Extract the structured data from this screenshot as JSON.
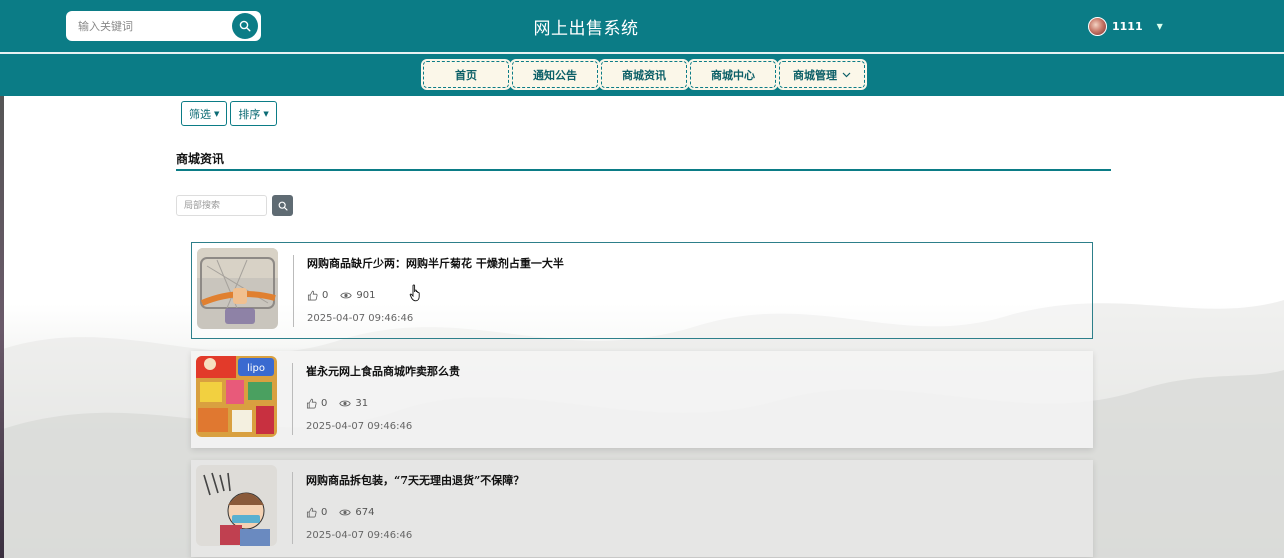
{
  "header": {
    "search_placeholder": "输入关键词",
    "site_title": "网上出售系统",
    "user_name": "1111",
    "accent_color": "#0b7c86"
  },
  "nav": {
    "items": [
      {
        "label": "首页"
      },
      {
        "label": "通知公告"
      },
      {
        "label": "商城资讯",
        "active": true
      },
      {
        "label": "商城中心"
      },
      {
        "label": "商城管理"
      }
    ]
  },
  "filters": {
    "filter_label": "筛选",
    "sort_label": "排序"
  },
  "section": {
    "title": "商城资讯",
    "local_search_placeholder": "局部搜索"
  },
  "articles": [
    {
      "title": "网购商品缺斤少两：网购半斤菊花 干燥剂占重一大半",
      "likes": "0",
      "views": "901",
      "date": "2025-04-07 09:46:46"
    },
    {
      "title": "崔永元网上食品商城咋卖那么贵",
      "likes": "0",
      "views": "31",
      "date": "2025-04-07 09:46:46"
    },
    {
      "title": "网购商品拆包装，“7天无理由退货”不保障？",
      "likes": "0",
      "views": "674",
      "date": "2025-04-07 09:46:46"
    }
  ],
  "icons": {
    "search": "search-icon",
    "like": "thumbs-up-icon",
    "view": "eye-icon",
    "dropdown": "caret-down-icon"
  }
}
